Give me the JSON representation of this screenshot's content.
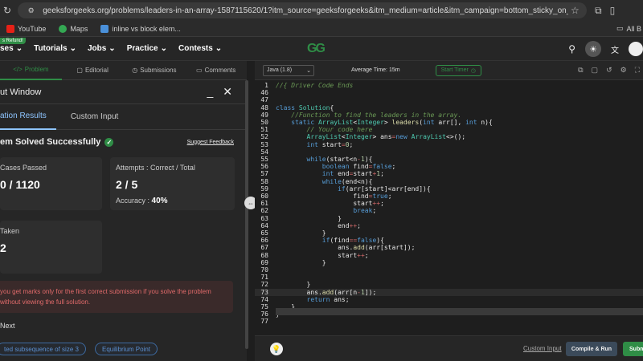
{
  "browser": {
    "url": "geeksforgeeks.org/problems/leaders-in-an-array-1587115620/1?itm_source=geeksforgeeks&itm_medium=article&itm_campaign=bottom_sticky_on_article",
    "bookmarks": [
      {
        "label": "YouTube",
        "color": "#e62117"
      },
      {
        "label": "Maps",
        "color": "#34a853"
      },
      {
        "label": "inline vs block elem...",
        "color": "#4a90d9"
      }
    ],
    "bookmarks_right": "All B"
  },
  "site": {
    "badge": "s Refund!",
    "nav": [
      "ses",
      "Tutorials",
      "Jobs",
      "Practice",
      "Contests"
    ],
    "logo": "GG",
    "brand_color": "#2f8d46"
  },
  "left": {
    "tabs": [
      {
        "icon": "</>",
        "label": "Problem",
        "active": true
      },
      {
        "icon": "▢",
        "label": "Editorial"
      },
      {
        "icon": "◷",
        "label": "Submissions"
      },
      {
        "icon": "▭",
        "label": "Comments"
      }
    ],
    "output_title": "ut Window",
    "subtabs": [
      "ation Results",
      "Custom Input"
    ],
    "solved": "em Solved Successfully",
    "feedback": "Suggest Feedback",
    "cards": {
      "cases_label": "Cases Passed",
      "cases_value": "0 / 1120",
      "attempts_label": "Attempts : Correct / Total",
      "attempts_value": "2 / 5",
      "accuracy_label": "Accuracy :",
      "accuracy_value": "40%",
      "time_label": "Taken",
      "time_value": "2"
    },
    "note_line1": "you get marks only for the first correct submission if you solve the problem",
    "note_line2": "without viewing the full solution.",
    "next_label": "Next",
    "chips": [
      "ted subsequence of size 3",
      "Equilibrium Point"
    ]
  },
  "editor": {
    "language": "Java (1.8)",
    "avg_time": "Average Time: 15m",
    "timer": "Start Timer",
    "custom_input": "Custom Input",
    "compile_run": "Compile & Run",
    "submit": "Subm"
  },
  "code_lines": [
    {
      "n": "1",
      "text": "//{ Driver Code Ends"
    },
    {
      "n": "46",
      "text": ""
    },
    {
      "n": "47",
      "text": ""
    },
    {
      "n": "48",
      "text": "class Solution{"
    },
    {
      "n": "49",
      "text": "    //Function to find the leaders in the array."
    },
    {
      "n": "50",
      "text": "    static ArrayList<Integer> leaders(int arr[], int n){"
    },
    {
      "n": "51",
      "text": "        // Your code here"
    },
    {
      "n": "52",
      "text": "        ArrayList<Integer> ans=new ArrayList<>();"
    },
    {
      "n": "53",
      "text": "        int start=0;"
    },
    {
      "n": "54",
      "text": ""
    },
    {
      "n": "55",
      "text": "        while(start<n-1){"
    },
    {
      "n": "56",
      "text": "            boolean find=false;"
    },
    {
      "n": "57",
      "text": "            int end=start+1;"
    },
    {
      "n": "58",
      "text": "            while(end<n){"
    },
    {
      "n": "59",
      "text": "                if(arr[start]<arr[end]){"
    },
    {
      "n": "60",
      "text": "                    find=true;"
    },
    {
      "n": "61",
      "text": "                    start++;"
    },
    {
      "n": "62",
      "text": "                    break;"
    },
    {
      "n": "63",
      "text": "                }"
    },
    {
      "n": "64",
      "text": "                end++;"
    },
    {
      "n": "65",
      "text": "            }"
    },
    {
      "n": "66",
      "text": "            if(find==false){"
    },
    {
      "n": "67",
      "text": "                ans.add(arr[start]);"
    },
    {
      "n": "68",
      "text": "                start++;"
    },
    {
      "n": "69",
      "text": "            }"
    },
    {
      "n": "70",
      "text": ""
    },
    {
      "n": "71",
      "text": ""
    },
    {
      "n": "72",
      "text": "        }"
    },
    {
      "n": "73",
      "text": "        ans.add(arr[n-1]);"
    },
    {
      "n": "74",
      "text": "        return ans;"
    },
    {
      "n": "75",
      "text": "    }"
    },
    {
      "n": "76",
      "text": "}"
    },
    {
      "n": "77",
      "text": ""
    }
  ]
}
